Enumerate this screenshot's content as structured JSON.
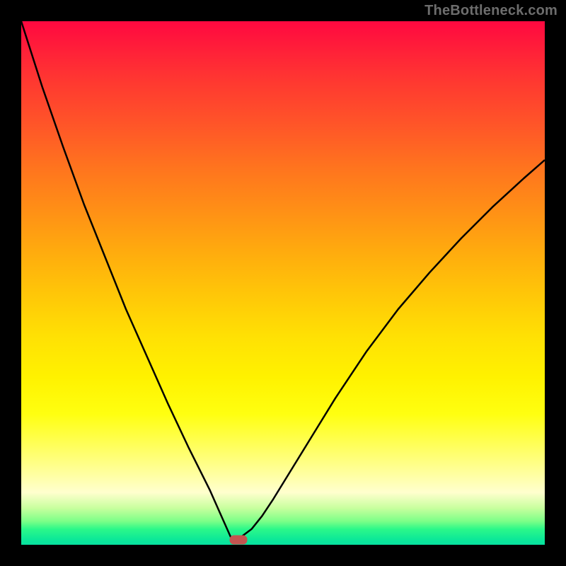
{
  "watermark": "TheBottleneck.com",
  "marker": {
    "x_pct": 41.5,
    "y_pct": 99.0
  },
  "chart_data": {
    "type": "line",
    "title": "",
    "xlabel": "",
    "ylabel": "",
    "xlim": [
      0,
      100
    ],
    "ylim": [
      0,
      100
    ],
    "note": "Axes unlabeled; values are relative % of plot area. y=0 at top, y=100 at bottom (green). Curve = bottleneck percentage; minimum (~0) near x≈41.",
    "x": [
      0,
      4,
      8,
      12,
      16,
      20,
      24,
      28,
      32,
      34,
      36,
      38,
      40,
      42,
      44,
      46,
      48,
      52,
      56,
      60,
      66,
      72,
      78,
      84,
      90,
      96,
      100
    ],
    "y": [
      0,
      12.5,
      24,
      35,
      45,
      55,
      64,
      73,
      81.5,
      85.5,
      89.5,
      94,
      98.5,
      98.5,
      97,
      94.5,
      91.5,
      85,
      78.5,
      72,
      63,
      55,
      48,
      41.5,
      35.5,
      30,
      26.5
    ]
  }
}
